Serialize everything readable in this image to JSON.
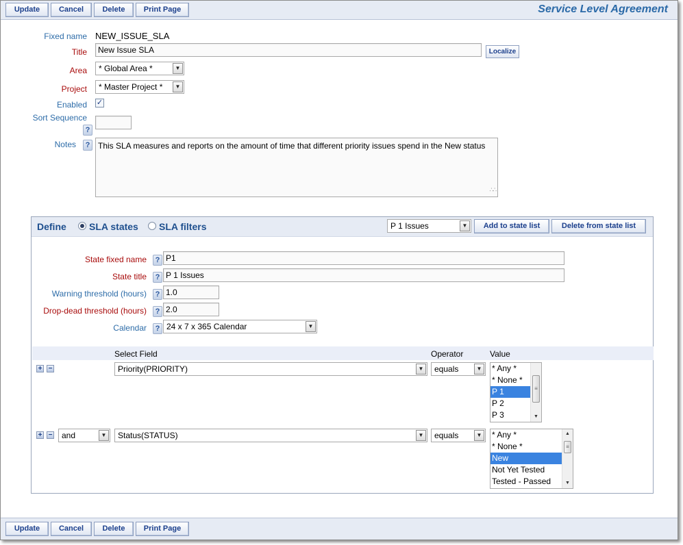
{
  "toolbar": {
    "update": "Update",
    "cancel": "Cancel",
    "delete": "Delete",
    "print": "Print Page"
  },
  "page_title": "Service Level Agreement",
  "form": {
    "fixed_name_label": "Fixed name",
    "fixed_name_value": "NEW_ISSUE_SLA",
    "title_label": "Title",
    "title_value": "New Issue SLA",
    "localize_label": "Localize",
    "area_label": "Area",
    "area_value": "* Global Area *",
    "project_label": "Project",
    "project_value": "* Master Project *",
    "enabled_label": "Enabled",
    "enabled_checked": true,
    "sort_label": "Sort Sequence",
    "sort_value": "",
    "notes_label": "Notes",
    "notes_value": "This SLA measures and reports on the amount of time that different priority issues spend in the New status"
  },
  "define": {
    "label": "Define",
    "radio_states": "SLA states",
    "radio_filters": "SLA filters",
    "selected": "states",
    "state_select_value": "P 1 Issues",
    "add_button": "Add to state list",
    "delete_button": "Delete from state list"
  },
  "state": {
    "fixed_name_label": "State fixed name",
    "fixed_name_value": "P1",
    "title_label": "State title",
    "title_value": "P 1 Issues",
    "warning_label": "Warning threshold (hours)",
    "warning_value": "1.0",
    "dropdead_label": "Drop-dead threshold (hours)",
    "dropdead_value": "2.0",
    "calendar_label": "Calendar",
    "calendar_value": "24 x 7 x 365 Calendar"
  },
  "filters": {
    "headers": {
      "field": "Select Field",
      "operator": "Operator",
      "value": "Value"
    },
    "rows": [
      {
        "connector": "",
        "field": "Priority(PRIORITY)",
        "operator": "equals",
        "options": [
          "* Any *",
          "* None *",
          "P 1",
          "P 2",
          "P 3"
        ],
        "selected_index": 2
      },
      {
        "connector": "and",
        "field": "Status(STATUS)",
        "operator": "equals",
        "options": [
          "* Any *",
          "* None *",
          "New",
          "Not Yet Tested",
          "Tested - Passed"
        ],
        "selected_index": 2
      }
    ]
  },
  "colors": {
    "label_blue": "#2d6ca8",
    "label_required_red": "#a80b0b",
    "toolbar_bg": "#e6ebf4",
    "selected_option_bg": "#3a83e0"
  }
}
